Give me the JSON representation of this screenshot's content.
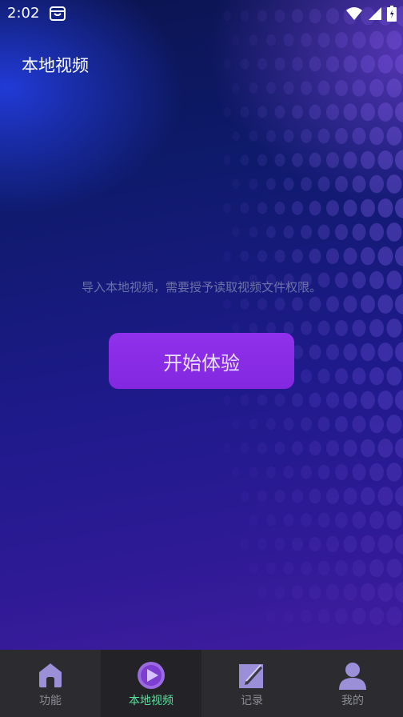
{
  "status_bar": {
    "time": "2:02",
    "icons": [
      "shopping-bag-icon",
      "wifi-icon",
      "signal-icon",
      "battery-icon"
    ]
  },
  "header": {
    "title": "本地视频"
  },
  "main": {
    "permission_hint": "导入本地视频，需要授予读取视频文件权限。",
    "start_button_label": "开始体验"
  },
  "bottom_nav": {
    "items": [
      {
        "label": "功能",
        "icon": "home-icon"
      },
      {
        "label": "本地视频",
        "icon": "play-circle-icon",
        "active": true
      },
      {
        "label": "记录",
        "icon": "note-edit-icon"
      },
      {
        "label": "我的",
        "icon": "user-icon"
      }
    ]
  },
  "colors": {
    "accent_button": "#8a2be2",
    "active_tab": "#55e39a",
    "nav_background": "#2b2b30",
    "icon_purple": "#9b8fd8"
  }
}
